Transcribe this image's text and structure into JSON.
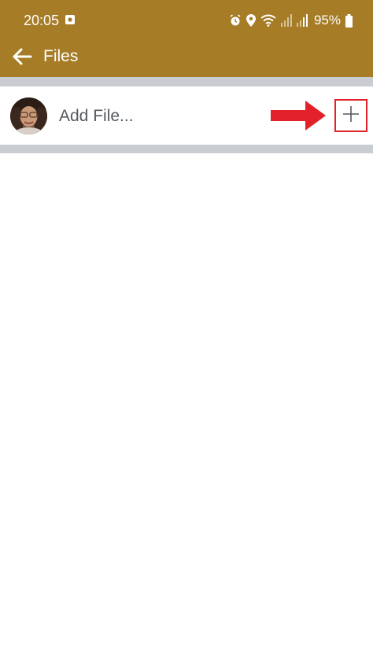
{
  "status_bar": {
    "time": "20:05",
    "battery": "95%",
    "icons": [
      "notification-icon",
      "alarm-icon",
      "location-icon",
      "wifi-icon",
      "signal-icon",
      "signal-icon",
      "battery-icon"
    ]
  },
  "toolbar": {
    "back_icon": "arrow-left-icon",
    "title": "Files"
  },
  "file_row": {
    "avatar": "user-avatar",
    "label": "Add File...",
    "add_icon": "plus-icon",
    "annotation": "red-arrow-pointer"
  },
  "colors": {
    "appbar": "#a67c26",
    "divider": "#c9cdd1",
    "annotation_red": "#e3212a",
    "label_text": "#555a5e"
  }
}
